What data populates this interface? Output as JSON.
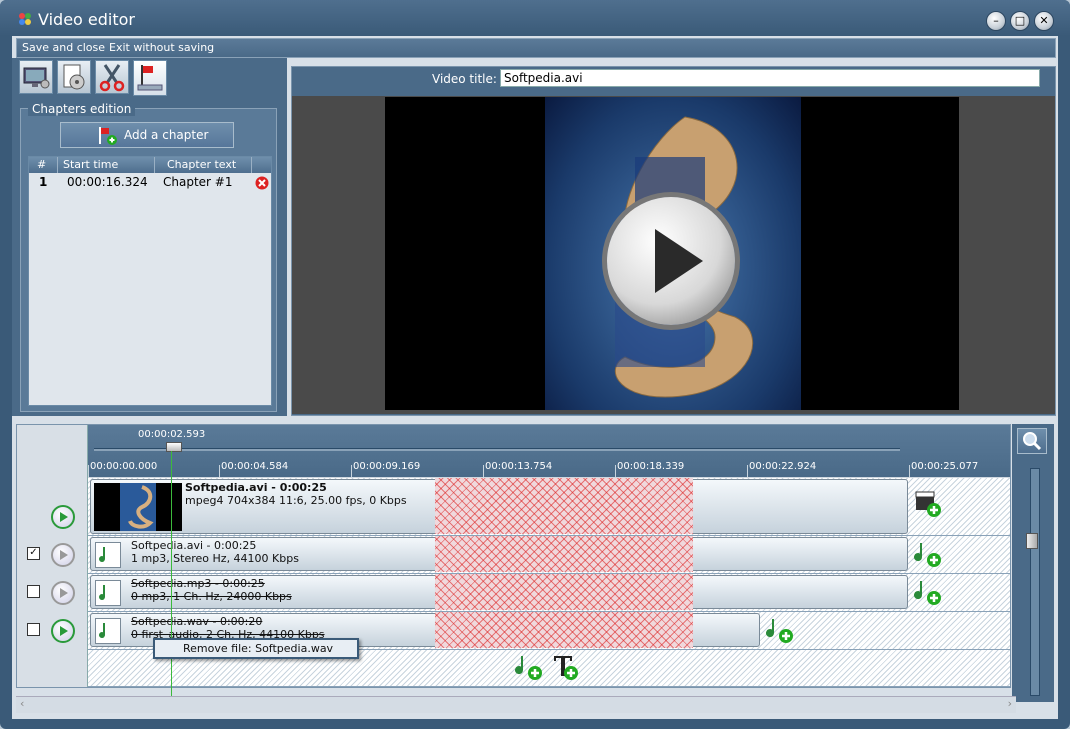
{
  "window": {
    "title": "Video editor",
    "icon": "colorful-app-icon"
  },
  "window_controls": {
    "minimize": "–",
    "maximize": "□",
    "close": "✕"
  },
  "menu": {
    "save_close": "Save and close",
    "exit": "Exit without saving"
  },
  "toolbar": {
    "icons": [
      "monitor-settings-icon",
      "video-disc-icon",
      "scissors-icon",
      "chapters-flag-icon"
    ]
  },
  "chapters": {
    "legend": "Chapters edition",
    "add_button": "Add a chapter",
    "headers": {
      "num": "#",
      "start": "Start time",
      "text": "Chapter text"
    },
    "rows": [
      {
        "num": "1",
        "start": "00:00:16.324",
        "text": "Chapter #1"
      }
    ]
  },
  "preview": {
    "title_label": "Video title:",
    "title_value": "Softpedia.avi"
  },
  "timeline": {
    "cursor_time": "00:00:02.593",
    "slider_position": 0.1,
    "ticks": [
      "00:00:00.000",
      "00:00:04.584",
      "00:00:09.169",
      "00:00:13.754",
      "00:00:18.339",
      "00:00:22.924",
      "00:00:25.077"
    ],
    "tracks": [
      {
        "title": "Softpedia.avi - 0:00:25",
        "info": "mpeg4 704x384 11:6, 25.00 fps, 0 Kbps"
      },
      {
        "title": "Softpedia.avi - 0:00:25",
        "info": "1 mp3, Stereo Hz, 44100 Kbps"
      },
      {
        "title": "Softpedia.mp3 - 0:00:25",
        "info": "0 mp3, 1 Ch. Hz, 24000 Kbps"
      },
      {
        "title": "Softpedia.wav - 0:00:20",
        "info": "0 first_audio, 2 Ch. Hz, 44100 Kbps"
      }
    ],
    "checkbox_track2": true,
    "checkbox_track3": false,
    "checkbox_track4": false,
    "context_menu": "Remove file: Softpedia.wav"
  },
  "colors": {
    "accent": "#3a5a78",
    "playhead": "#3cba3c",
    "hatch": "#dd2a2a"
  }
}
